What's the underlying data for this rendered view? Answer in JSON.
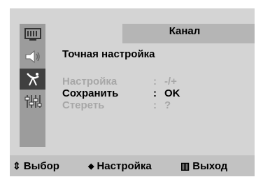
{
  "menu": {
    "title": "Канал",
    "subtitle": "Точная настройка",
    "side_icons": [
      "picture-icon",
      "sound-icon",
      "channel-antenna-icon",
      "setup-sliders-icon"
    ],
    "active_icon_index": 2
  },
  "settings": [
    {
      "label": "Настройка",
      "colon": ":",
      "value": "-/+",
      "state": "dim"
    },
    {
      "label": "Сохранить",
      "colon": ":",
      "value": "OK",
      "state": "selected"
    },
    {
      "label": "Стереть",
      "colon": ":",
      "value": "?",
      "state": "dim"
    }
  ],
  "footer": {
    "move": {
      "icon": "up-down-arrows-icon",
      "glyph": "⇕",
      "label": "Выбор"
    },
    "adjust": {
      "icon": "left-right-arrows-icon",
      "glyph": "◆",
      "label": "Настройка"
    },
    "exit": {
      "icon": "menu-exit-icon",
      "glyph": "▥",
      "label": "Выход"
    }
  },
  "colors": {
    "panel_bg": "#d4d4d4",
    "sidebar_bg": "#9c9c9c",
    "active_icon_bg": "#404040",
    "header_bg": "#b5b5b5",
    "dim_text": "#a7a7a7",
    "footer_bg": "#c2c2c2"
  }
}
